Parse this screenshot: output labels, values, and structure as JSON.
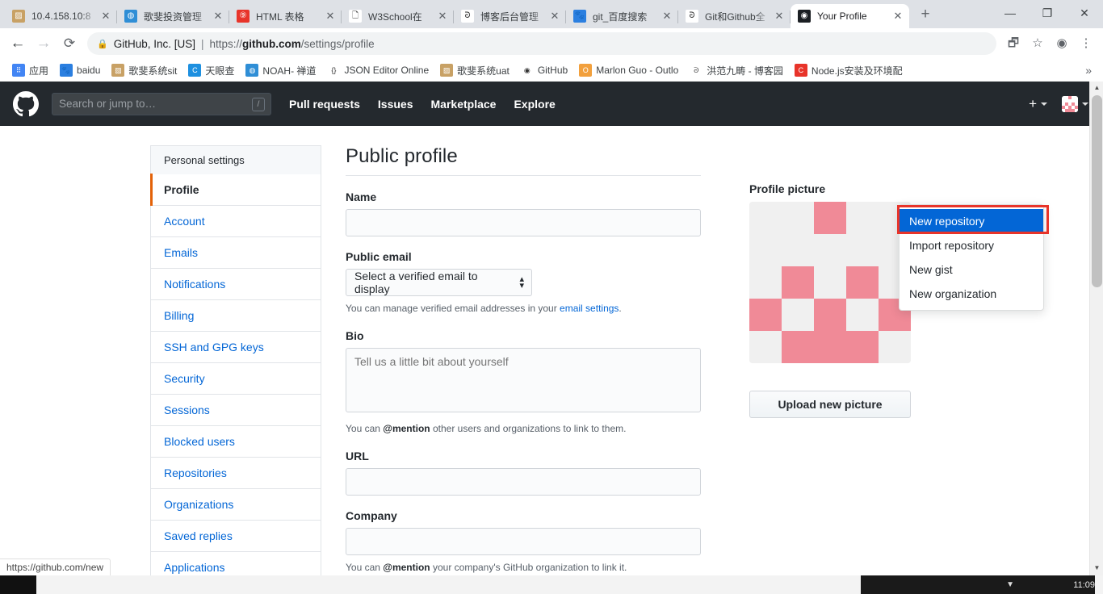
{
  "browser": {
    "tabs": [
      {
        "title": "10.4.158.10:8",
        "icon_name": "generic-page-icon",
        "icon_color": "#c8a165",
        "icon_char": "▨"
      },
      {
        "title": "歌斐投资管理",
        "icon_name": "globe-icon",
        "icon_color": "#2f8ed6",
        "icon_char": "◍"
      },
      {
        "title": "HTML 表格",
        "icon_name": "w3school-icon",
        "icon_color": "#e8342a",
        "icon_char": "⑨"
      },
      {
        "title": "W3School在",
        "icon_name": "document-icon",
        "icon_color": "#ffffff",
        "icon_char": "🗋"
      },
      {
        "title": "博客后台管理",
        "icon_name": "cnblogs-icon",
        "icon_color": "#ffffff",
        "icon_char": "ᘒ"
      },
      {
        "title": "git_百度搜索",
        "icon_name": "baidu-icon",
        "icon_color": "#2b7fe0",
        "icon_char": "🐾"
      },
      {
        "title": "Git和Github全",
        "icon_name": "cnblogs-icon",
        "icon_color": "#ffffff",
        "icon_char": "ᘒ"
      },
      {
        "title": "Your Profile",
        "icon_name": "github-icon",
        "icon_color": "#1b1f23",
        "icon_char": "◉"
      }
    ],
    "active_tab_index": 7,
    "close_label": "✕",
    "newtab_label": "+",
    "window_controls": {
      "minimize": "—",
      "maximize": "❐",
      "close": "✕"
    },
    "nav": {
      "back": "←",
      "forward": "→",
      "reload": "⟳"
    },
    "omnibox": {
      "lock_icon": "🔒",
      "site_identity": "GitHub, Inc. [US]",
      "separator": "|",
      "url_scheme": "https://",
      "url_host": "github.com",
      "url_path": "/settings/profile"
    },
    "toolbar_icons": [
      {
        "name": "translate-icon",
        "glyph": "🗗"
      },
      {
        "name": "bookmark-star-icon",
        "glyph": "☆"
      },
      {
        "name": "profile-avatar-icon",
        "glyph": "◉"
      },
      {
        "name": "chrome-menu-icon",
        "glyph": "⋮"
      }
    ],
    "bookmarks": [
      {
        "label": "应用",
        "icon_name": "apps-grid-icon",
        "color": "#4285f4",
        "char": "⠿"
      },
      {
        "label": "baidu",
        "icon_name": "baidu-icon",
        "color": "#2b7fe0",
        "char": "🐾"
      },
      {
        "label": "歌斐系统sit",
        "icon_name": "generic-page-icon",
        "color": "#c8a165",
        "char": "▨"
      },
      {
        "label": "天眼查",
        "icon_name": "tianyancha-icon",
        "color": "#1e90e0",
        "char": "C"
      },
      {
        "label": "NOAH- 禅道",
        "icon_name": "globe-icon",
        "color": "#2f8ed6",
        "char": "◍"
      },
      {
        "label": "JSON Editor Online",
        "icon_name": "json-braces-icon",
        "color": "#ffffff",
        "char": "{}"
      },
      {
        "label": "歌斐系统uat",
        "icon_name": "generic-page-icon",
        "color": "#c8a165",
        "char": "▨"
      },
      {
        "label": "GitHub",
        "icon_name": "github-icon",
        "color": "#ffffff",
        "char": "◉"
      },
      {
        "label": "Marlon Guo - Outlo",
        "icon_name": "outlook-icon",
        "color": "#f2a03d",
        "char": "O"
      },
      {
        "label": "洪范九畴 - 博客园",
        "icon_name": "cnblogs-icon",
        "color": "#ffffff",
        "char": "ᘒ"
      },
      {
        "label": "Node.js安装及环境配",
        "icon_name": "cnblogs-red-icon",
        "color": "#e8342a",
        "char": "C"
      }
    ],
    "bookmarks_overflow": "»",
    "status_bar_url": "https://github.com/new"
  },
  "github": {
    "logo_name": "github-mark-icon",
    "search": {
      "placeholder": "Search or jump to…",
      "shortcut_key": "/"
    },
    "nav_items": [
      "Pull requests",
      "Issues",
      "Marketplace",
      "Explore"
    ],
    "create_new": {
      "name": "create-new-menu",
      "plus_label": "+",
      "menu_items": [
        "New repository",
        "Import repository",
        "New gist",
        "New organization"
      ],
      "selected_index": 0,
      "highlight_color": "#e8342a",
      "selected_bg": "#0366d6"
    },
    "avatar_name": "user-avatar"
  },
  "settings": {
    "sidebar": {
      "heading": "Personal settings",
      "items": [
        "Profile",
        "Account",
        "Emails",
        "Notifications",
        "Billing",
        "SSH and GPG keys",
        "Security",
        "Sessions",
        "Blocked users",
        "Repositories",
        "Organizations",
        "Saved replies",
        "Applications"
      ],
      "active_index": 0,
      "active_marker_color": "#e36209"
    },
    "page_title": "Public profile",
    "fields": {
      "name": {
        "label": "Name",
        "value": "",
        "placeholder": ""
      },
      "public_email": {
        "label": "Public email",
        "selected_option": "Select a verified email to display",
        "hint_pre": "You can manage verified email addresses in your ",
        "hint_link": "email settings",
        "hint_post": "."
      },
      "bio": {
        "label": "Bio",
        "value": "",
        "placeholder": "Tell us a little bit about yourself",
        "hint_pre": "You can ",
        "hint_bold": "@mention",
        "hint_post": " other users and organizations to link to them."
      },
      "url": {
        "label": "URL",
        "value": "",
        "placeholder": ""
      },
      "company": {
        "label": "Company",
        "value": "",
        "placeholder": "",
        "hint_pre": "You can ",
        "hint_bold": "@mention",
        "hint_post": " your company's GitHub organization to link it."
      }
    },
    "profile_picture": {
      "label": "Profile picture",
      "upload_button": "Upload new picture",
      "identicon_color": "#f08a97",
      "identicon_bg": "#f0f0f0",
      "identicon_grid": [
        [
          0,
          0,
          1,
          0,
          0
        ],
        [
          0,
          0,
          0,
          0,
          0
        ],
        [
          0,
          1,
          0,
          1,
          0
        ],
        [
          1,
          0,
          1,
          0,
          1
        ],
        [
          0,
          1,
          1,
          1,
          0
        ]
      ]
    }
  },
  "scrollbar": {
    "up_arrow": "▲",
    "down_arrow": "▼"
  },
  "taskbar": {
    "clock": "11:09"
  }
}
